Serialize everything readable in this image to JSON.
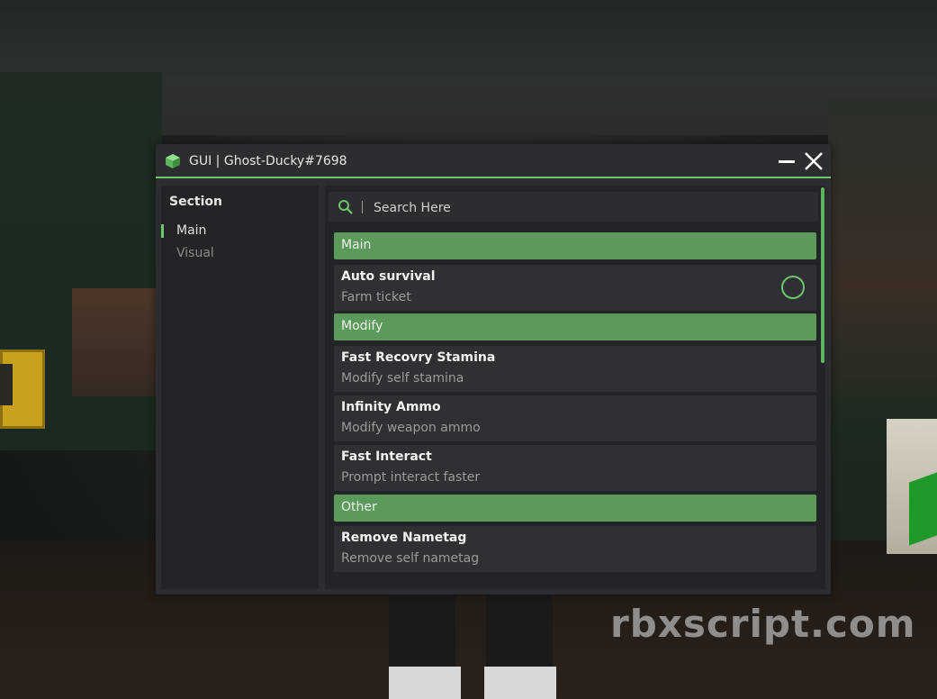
{
  "window": {
    "title": "GUI | Ghost-Ducky#7698"
  },
  "sidebar": {
    "section_title": "Section",
    "items": [
      {
        "label": "Main",
        "active": true
      },
      {
        "label": "Visual",
        "active": false
      }
    ]
  },
  "search": {
    "placeholder": "Search Here"
  },
  "groups": [
    {
      "header": "Main"
    },
    {
      "header": "Modify"
    },
    {
      "header": "Other"
    }
  ],
  "features": [
    {
      "name": "Auto survival",
      "desc": "Farm ticket"
    },
    {
      "name": "Fast Recovry Stamina",
      "desc": "Modify self stamina"
    },
    {
      "name": "Infinity Ammo",
      "desc": "Modify weapon ammo"
    },
    {
      "name": "Fast Interact",
      "desc": "Prompt interact faster"
    },
    {
      "name": "Remove Nametag",
      "desc": "Remove self nametag"
    }
  ],
  "watermark": "rbxscript.com",
  "colors": {
    "accent": "#6ec56e",
    "group_header": "#5b9a5b",
    "window_bg": "#2b2d30",
    "panel_bg": "#232427"
  }
}
